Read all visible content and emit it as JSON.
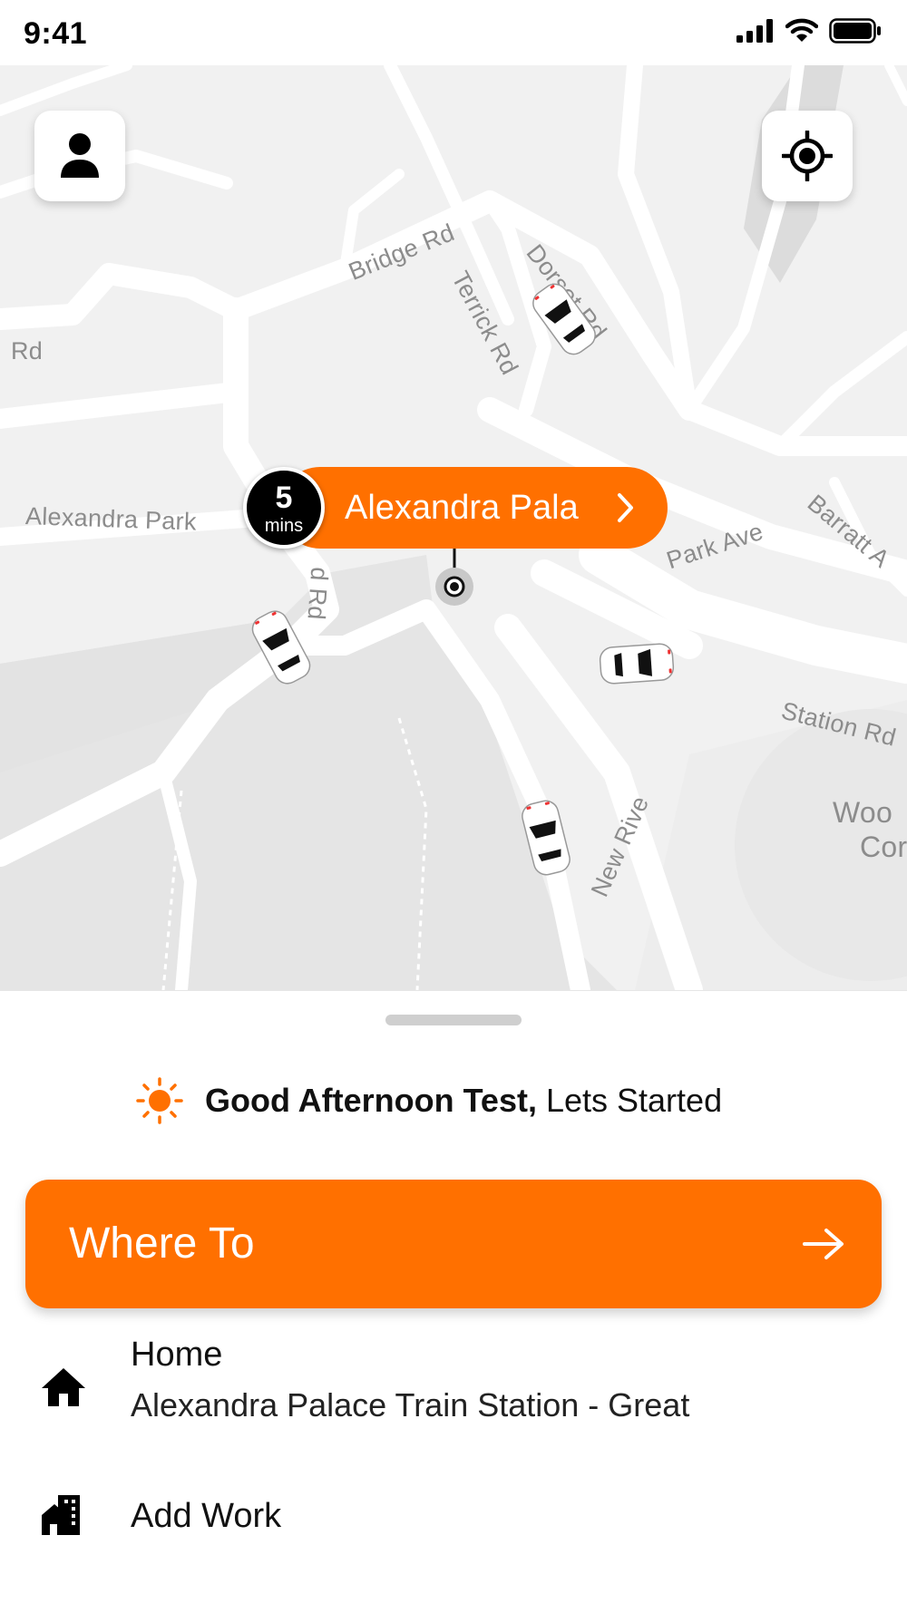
{
  "status_bar": {
    "time": "9:41"
  },
  "map": {
    "road_labels": {
      "bridge_rd": "Bridge Rd",
      "dorset_rd": "Dorset Rd",
      "terrick_rd": "Terrick Rd",
      "left_rd": "Rd",
      "alexandra_park": "Alexandra Park",
      "d_rd": "d Rd",
      "park_ave": "Park Ave",
      "barratt": "Barratt A",
      "station_rd": "Station Rd",
      "new_river": "New Rive",
      "wood_line1": "Woo",
      "wood_line2": "Cor"
    },
    "pickup": {
      "eta_number": "5",
      "eta_unit": "mins",
      "label": "Alexandra Pala"
    }
  },
  "sheet": {
    "greeting_bold": "Good Afternoon Test,",
    "greeting_rest": " Lets Started",
    "where_to_label": "Where To",
    "saved_places": {
      "home_title": "Home",
      "home_address": "Alexandra Palace Train Station - Great",
      "work_title": "Add Work"
    }
  },
  "colors": {
    "accent": "#ff7000",
    "map_bg": "#f1f1f1",
    "road": "#ffffff",
    "label": "#8c8c8c"
  },
  "icons": [
    "profile-icon",
    "locate-icon",
    "sun-icon",
    "arrow-right-icon",
    "home-icon",
    "work-building-icon",
    "car-icon",
    "location-pin-icon"
  ]
}
